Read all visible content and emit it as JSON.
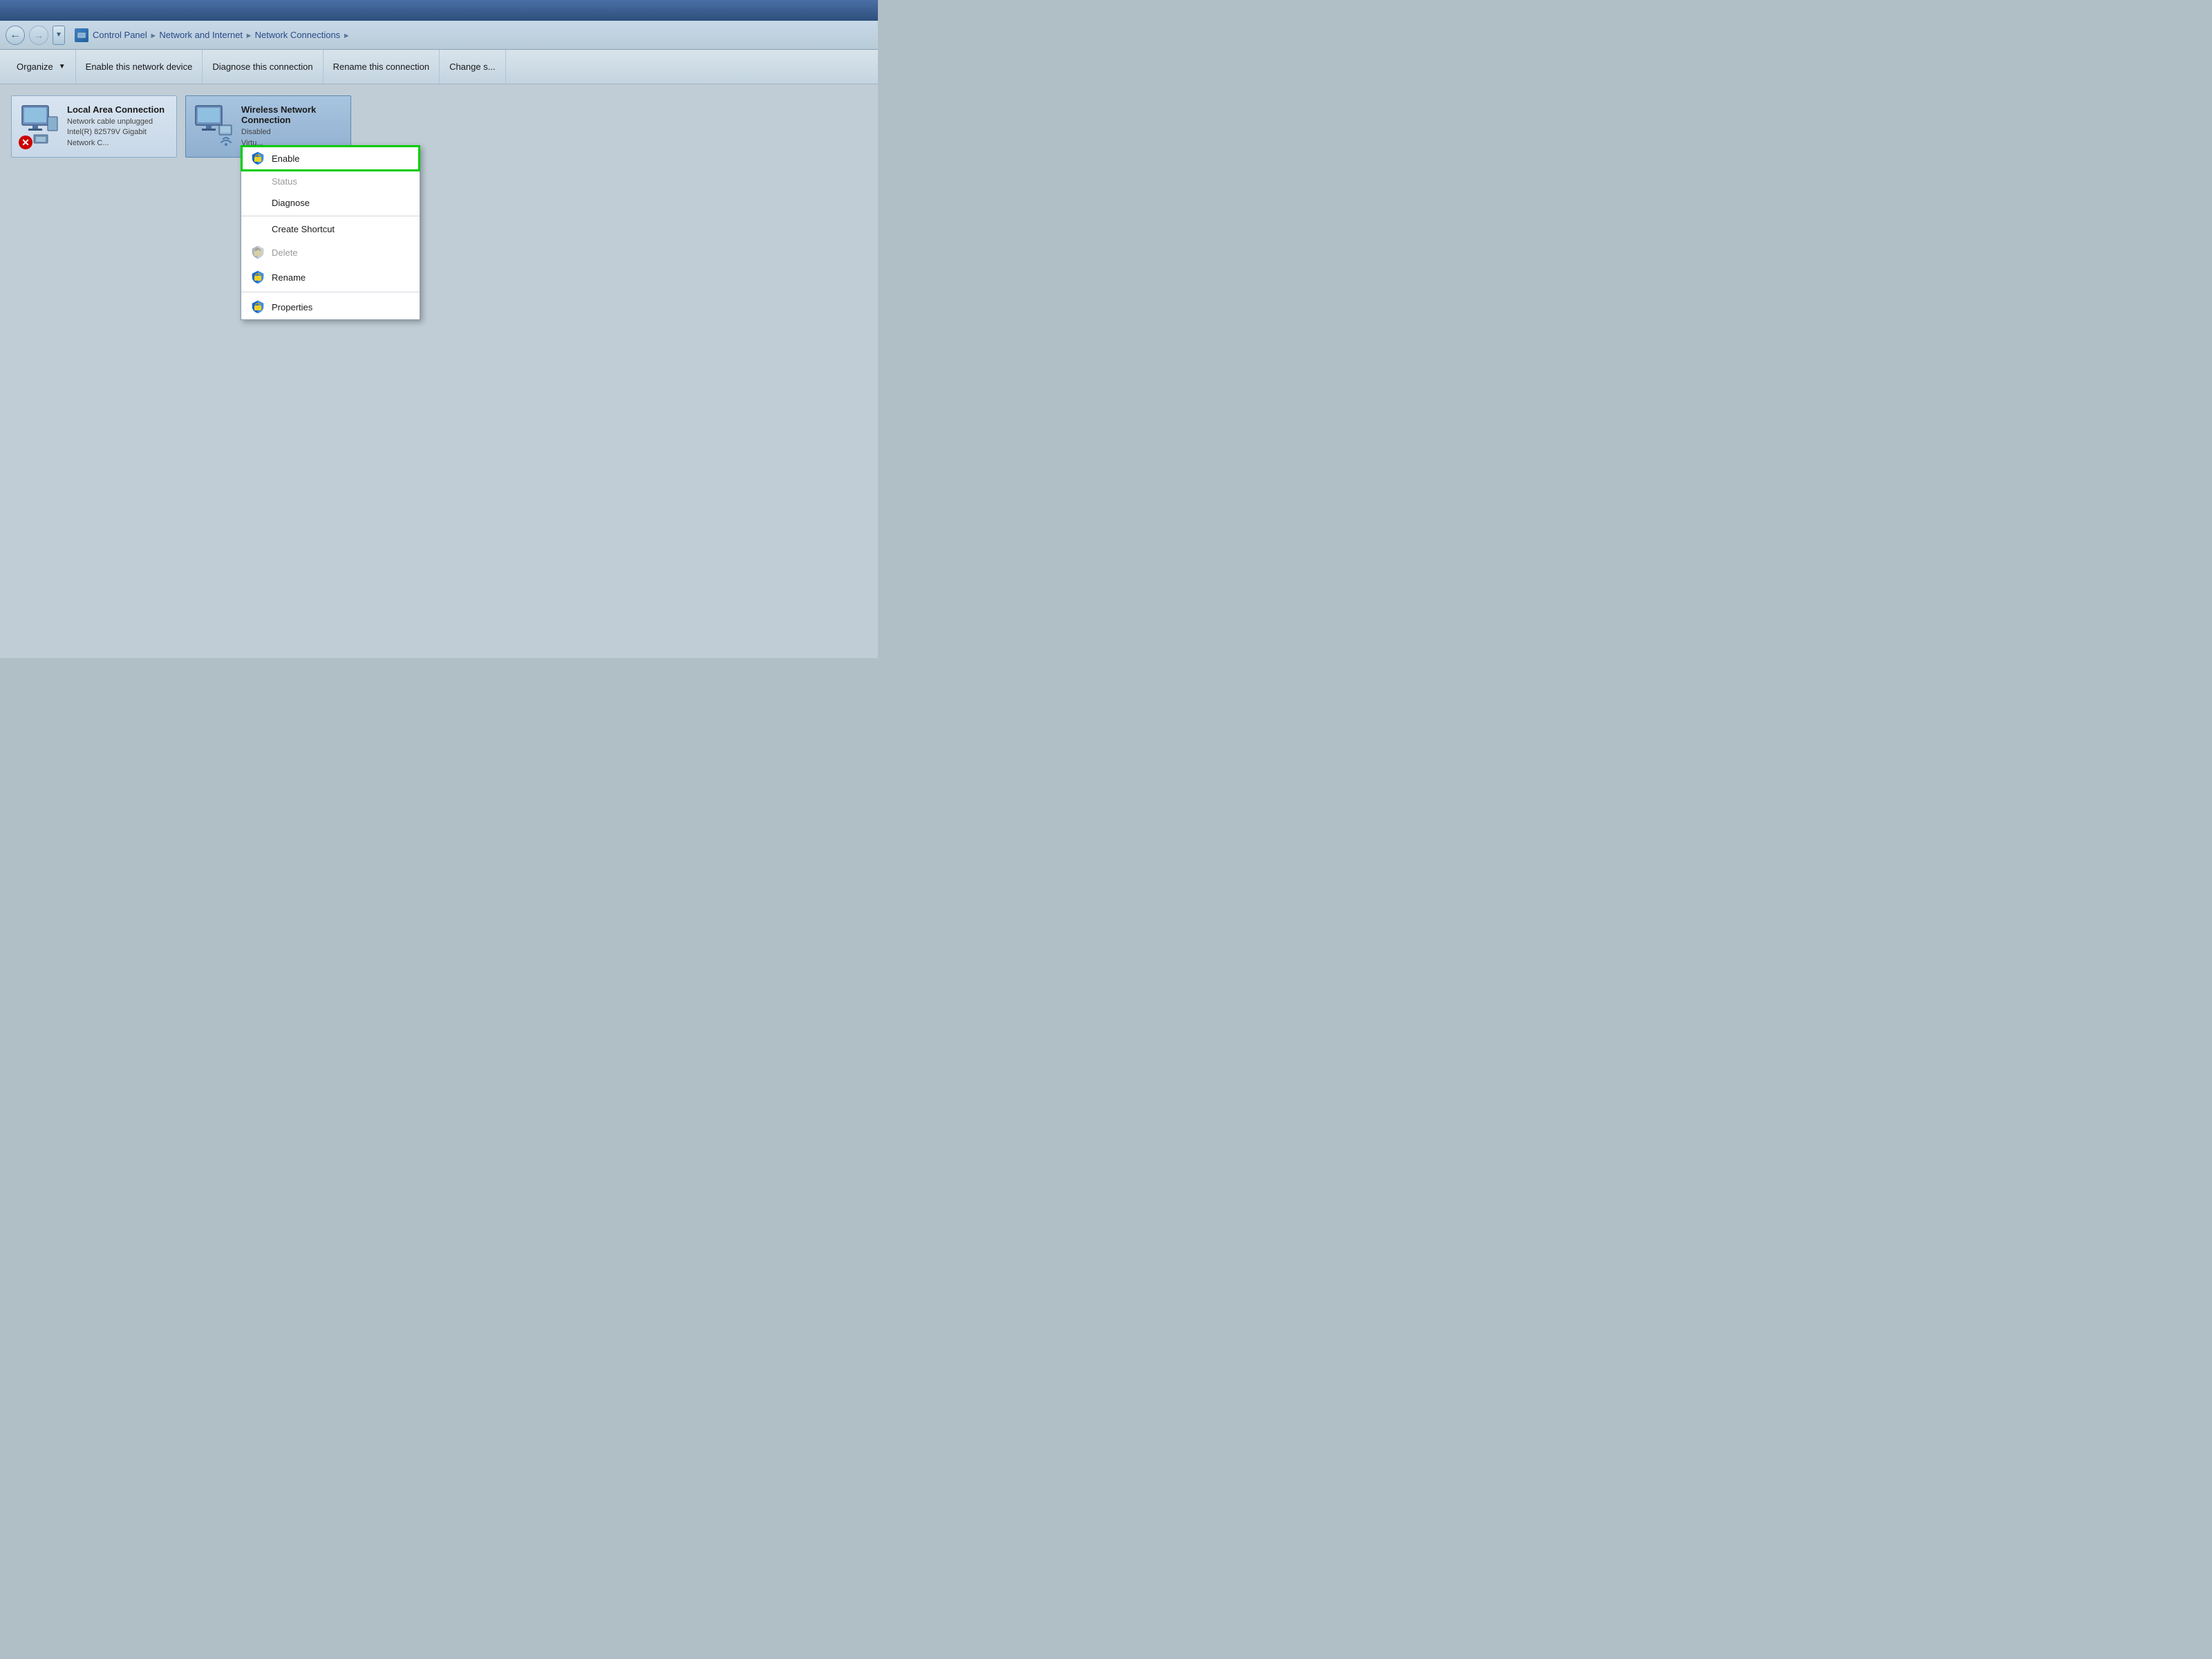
{
  "titleBar": {},
  "addressBar": {
    "pathParts": [
      "Control Panel",
      "Network and Internet",
      "Network Connections"
    ]
  },
  "toolbar": {
    "organize": "Organize",
    "enableDevice": "Enable this network device",
    "diagnose": "Diagnose this connection",
    "rename": "Rename this connection",
    "changeSettings": "Change s..."
  },
  "connections": [
    {
      "name": "Local Area Connection",
      "status1": "Network cable unplugged",
      "status2": "Intel(R) 82579V Gigabit Network C...",
      "hasError": true,
      "selected": false
    },
    {
      "name": "Wireless Network Connection",
      "status1": "Disabled",
      "status2": "Virtu...",
      "hasError": false,
      "selected": true
    }
  ],
  "contextMenu": {
    "items": [
      {
        "label": "Enable",
        "icon": "shield",
        "disabled": false,
        "highlighted": true,
        "separator": false
      },
      {
        "label": "Status",
        "icon": null,
        "disabled": true,
        "highlighted": false,
        "separator": false
      },
      {
        "label": "Diagnose",
        "icon": null,
        "disabled": false,
        "highlighted": false,
        "separator": false
      },
      {
        "label": "",
        "separator": true
      },
      {
        "label": "Create Shortcut",
        "icon": null,
        "disabled": false,
        "highlighted": false,
        "separator": false
      },
      {
        "label": "Delete",
        "icon": "shield-gray",
        "disabled": true,
        "highlighted": false,
        "separator": false
      },
      {
        "label": "Rename",
        "icon": "shield",
        "disabled": false,
        "highlighted": false,
        "separator": false
      },
      {
        "label": "",
        "separator": true
      },
      {
        "label": "Properties",
        "icon": "shield",
        "disabled": false,
        "highlighted": false,
        "separator": false
      }
    ]
  },
  "colors": {
    "accent": "#4a7aaa",
    "highlight": "#00cc00",
    "background": "#c0cdd6"
  }
}
